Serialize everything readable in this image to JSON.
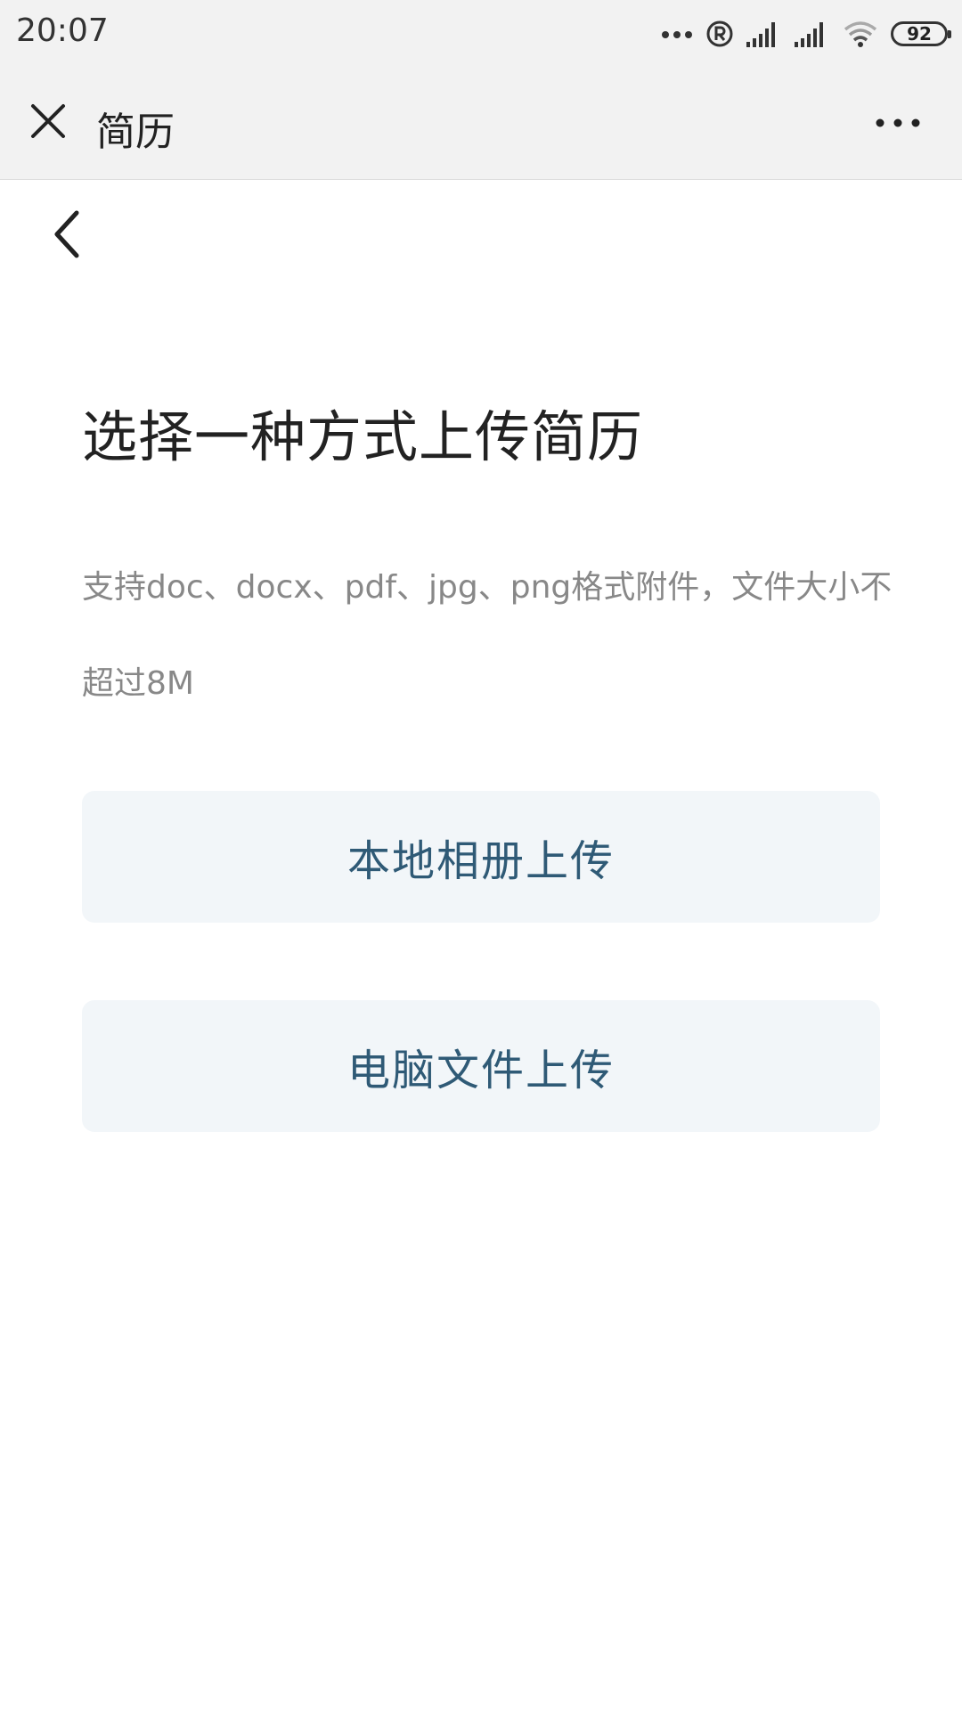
{
  "status_bar": {
    "time": "20:07",
    "battery_level": "92",
    "icons": [
      "more-dots-icon",
      "registered-icon",
      "signal-icon",
      "signal-icon",
      "wifi-icon",
      "battery-icon"
    ]
  },
  "title_bar": {
    "title": "简历",
    "close_icon": "close-icon",
    "more_icon": "more-icon"
  },
  "page": {
    "back_icon": "chevron-left-icon",
    "heading": "选择一种方式上传简历",
    "description": "支持doc、docx、pdf、jpg、png格式附件，文件大小不超过8M",
    "buttons": {
      "album": "本地相册上传",
      "computer": "电脑文件上传"
    }
  },
  "colors": {
    "bar_bg": "#f2f2f2",
    "button_bg": "#f2f6f9",
    "button_text": "#2f5a76",
    "desc_text": "#888888"
  }
}
